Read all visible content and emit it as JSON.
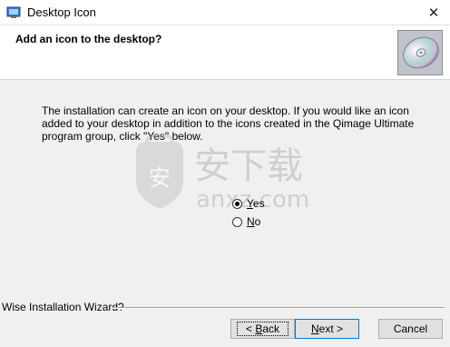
{
  "window": {
    "title": "Desktop Icon",
    "close_glyph": "✕"
  },
  "header": {
    "title": "Add an icon to the desktop?",
    "graphic": "cd-disc-icon"
  },
  "body": {
    "description": "The installation can create an icon on your desktop.  If you would like an icon added to your desktop in addition to the icons created in the Qimage Ultimate program group, click \"Yes\" below."
  },
  "options": [
    {
      "label": "Yes",
      "mnemonic_index": 0,
      "selected": true
    },
    {
      "label": "No",
      "mnemonic_index": 0,
      "selected": false
    }
  ],
  "footer": {
    "group_label": "Wise Installation Wizard?"
  },
  "buttons": {
    "back": {
      "prefix": "< ",
      "mnemonic": "B",
      "rest": "ack"
    },
    "next": {
      "mnemonic": "N",
      "rest": "ext >"
    },
    "cancel": "Cancel"
  },
  "watermark": {
    "cn_text": "安下载",
    "latin_text": "anxz.com",
    "badge_char": "安"
  }
}
